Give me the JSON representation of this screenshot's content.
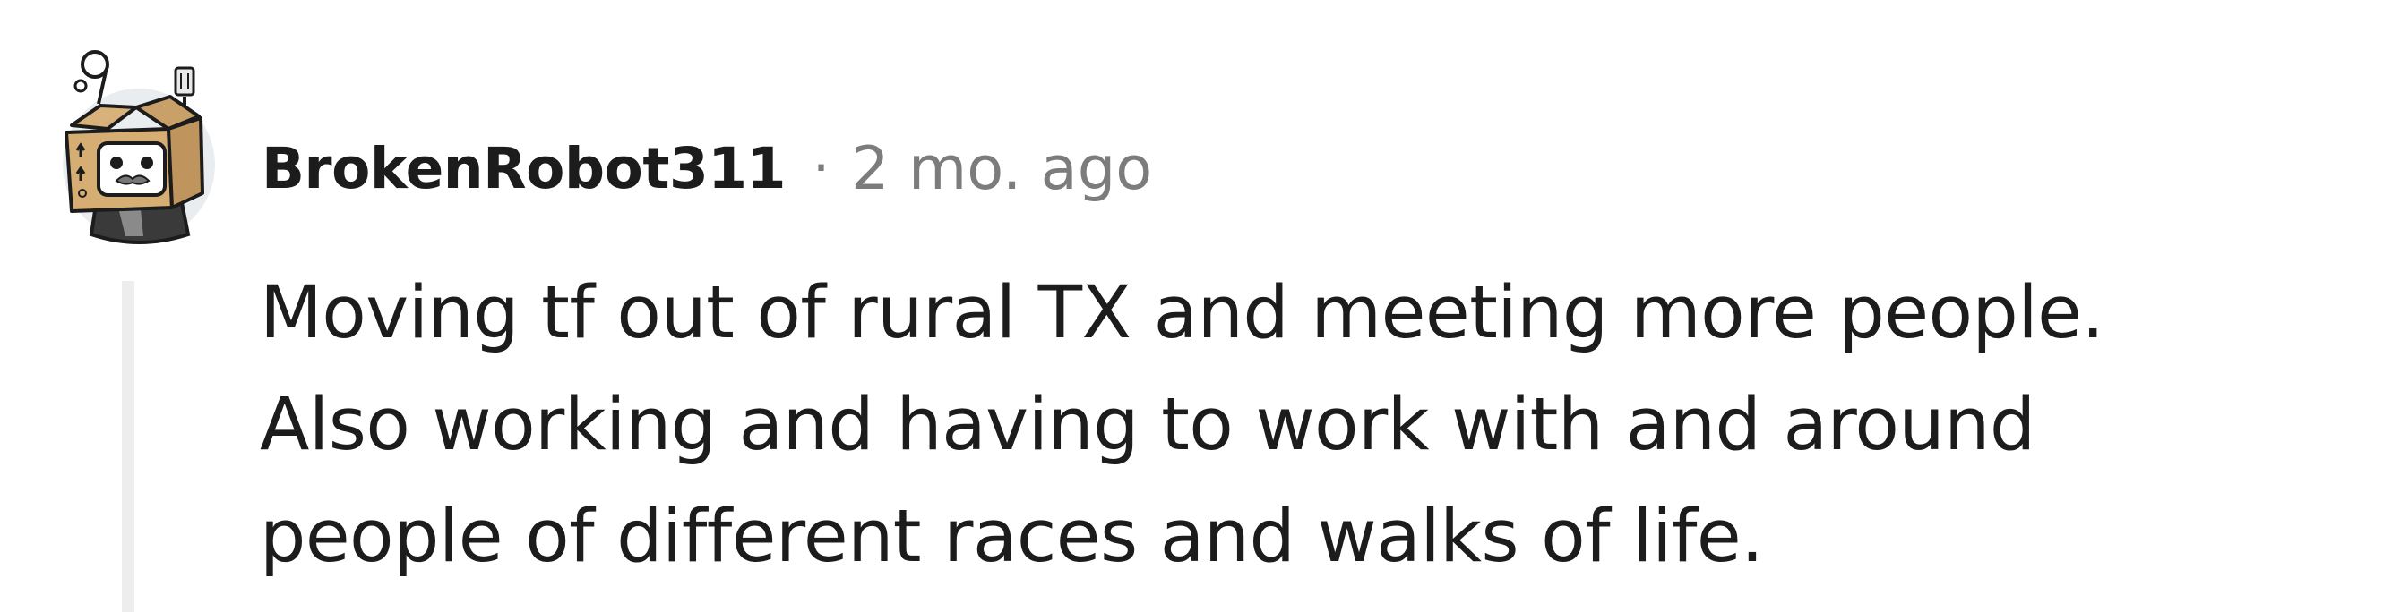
{
  "comment": {
    "author": "BrokenRobot311",
    "separator": "·",
    "timestamp": "2 mo. ago",
    "avatar_icon": "robot-box-avatar-icon",
    "body_lines": [
      "Moving tf out of rural TX and meeting more people.",
      "Also working and having to work with and around",
      "people of different races and walks of life."
    ]
  },
  "colors": {
    "text": "#1c1c1c",
    "meta": "#7c7c7c",
    "thread_line": "#ededed",
    "background": "#ffffff"
  }
}
